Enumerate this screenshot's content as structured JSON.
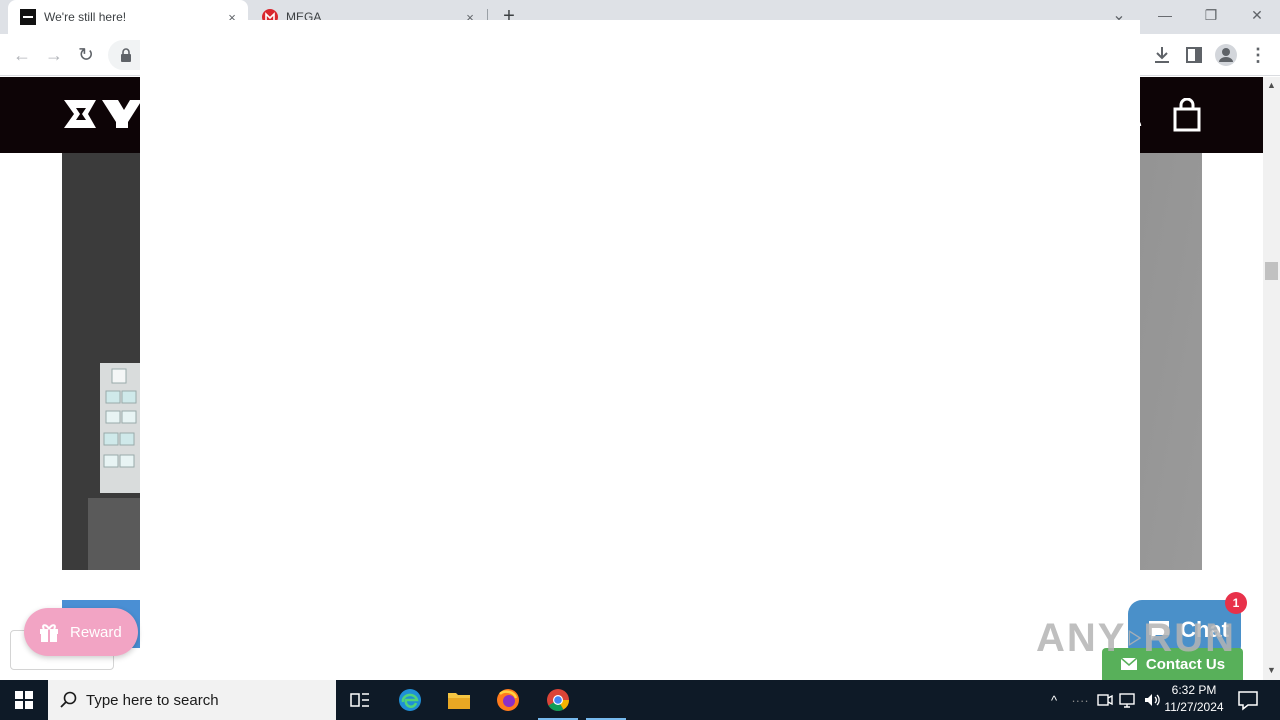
{
  "browser": {
    "tabs": [
      {
        "title": "We're still here!",
        "active": true
      },
      {
        "title": "MEGA",
        "active": false
      }
    ],
    "new_tab_label": "+",
    "tab_close_glyph": "×",
    "window_controls": {
      "minimize": "—",
      "maximize": "❐",
      "close": "✕"
    },
    "tab_search_glyph": "⌄"
  },
  "toolbar": {
    "back_glyph": "←",
    "forward_glyph": "→",
    "reload_glyph": "↻",
    "lock_icon": "lock-icon",
    "download_icon": "download-icon",
    "sidepanel_icon": "side-panel-icon",
    "profile_icon": "profile-icon",
    "menu_glyph": "⋮"
  },
  "page": {
    "reward_label": "Reward",
    "chat_label": "Chat",
    "chat_badge": "1",
    "contact_label": "Contact Us",
    "watermark_left": "ANY",
    "watermark_right": "RUN",
    "colors": {
      "header_bg": "#0d0406",
      "reward_bg": "#f2a4c4",
      "chat_bg": "#4a90c9",
      "badge_bg": "#e8314a",
      "contact_bg": "#58b05a"
    }
  },
  "taskbar": {
    "search_placeholder": "Type here to search",
    "time": "6:32 PM",
    "date": "11/27/2024",
    "apps": [
      "task-view-icon",
      "edge-icon",
      "file-explorer-icon",
      "firefox-icon",
      "chrome-icon"
    ]
  }
}
